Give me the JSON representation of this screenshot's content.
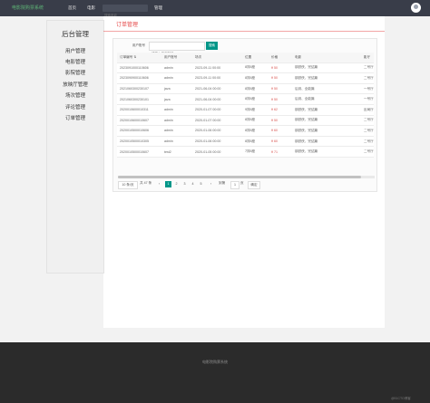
{
  "header": {
    "brand": "电影院购票系统",
    "nav": [
      "首页",
      "电影"
    ],
    "search_placeholder": "搜索电影",
    "admin_link": "管理"
  },
  "sidebar": {
    "title": "后台管理",
    "items": [
      "用户管理",
      "电影管理",
      "影院管理",
      "放映厅管理",
      "场次管理",
      "评论管理",
      "订单管理"
    ]
  },
  "page": {
    "title": "订单管理"
  },
  "search": {
    "label": "用户账号",
    "placeholder": "请输入用户账号",
    "button": "搜索"
  },
  "table": {
    "columns": [
      "订单编号 ⇅",
      "用户账号",
      "场次",
      "位置",
      "价格",
      "电影",
      "影厅"
    ],
    "rows": [
      [
        "2023091000110606",
        "admin",
        "2023-09-11 00:00",
        "8排8座",
        "¥ 50",
        "钢铁侠、完结篇",
        "二号厅"
      ],
      [
        "2023090900110606",
        "admin",
        "2023-09-11 00:00",
        "8排8座",
        "¥ 50",
        "钢铁侠、完结篇",
        "二号厅"
      ],
      [
        "2021060300230107",
        "java",
        "2021-06-04 00:00",
        "8排8座",
        "¥ 50",
        "后到、全能篇",
        "一号厅"
      ],
      [
        "2021060300230101",
        "java",
        "2021-06-04 00:00",
        "8排8座",
        "¥ 50",
        "后到、全能篇",
        "一号厅"
      ],
      [
        "2020010600010311",
        "admin",
        "2020-01-07 00:00",
        "9排8座",
        "¥ 62",
        "钢铁侠、完结篇",
        "反局厅"
      ],
      [
        "2020010600010607",
        "admin",
        "2020-01-07 00:00",
        "8排8座",
        "¥ 50",
        "钢铁侠、完结篇",
        "二号厅"
      ],
      [
        "2020010500010606",
        "admin",
        "2020-01-06 00:00",
        "8排8座",
        "¥ 60",
        "钢铁侠、完结篇",
        "二号厅"
      ],
      [
        "2020010500010305",
        "admin",
        "2020-01-06 00:00",
        "8排8座",
        "¥ 60",
        "钢铁侠、完结篇",
        "二号厅"
      ],
      [
        "2020010500010607",
        "test2",
        "2020-01-05 00:00",
        "7排8座",
        "¥ 71",
        "钢铁侠、完结篇",
        "二号厅"
      ]
    ]
  },
  "pagination": {
    "page_size": "10 条/页",
    "total": "共 47 条",
    "prev": "‹",
    "pages": [
      "1",
      "2",
      "3",
      "4",
      "5"
    ],
    "next": "›",
    "goto_label": "到第",
    "goto_value": "1",
    "page_unit": "页",
    "confirm": "确定"
  },
  "footer": {
    "text": "电影院购票系统",
    "watermark": "@51CTO博客"
  }
}
